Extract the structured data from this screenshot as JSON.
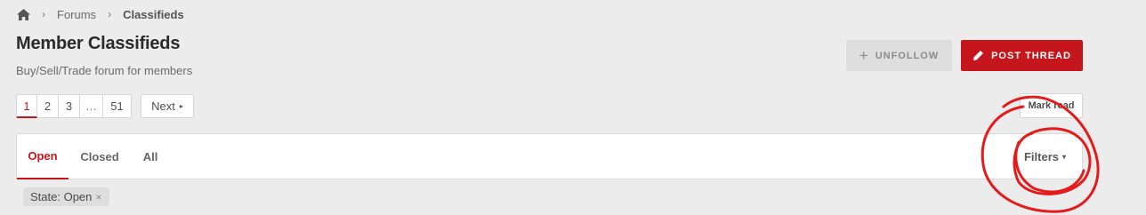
{
  "breadcrumb": {
    "home_icon": "home-icon",
    "items": [
      "Forums",
      "Classifieds"
    ],
    "separator": "›"
  },
  "header": {
    "title": "Member Classifieds",
    "description": "Buy/Sell/Trade forum for members"
  },
  "actions": {
    "unfollow_label": "UNFOLLOW",
    "unfollow_icon": "plus-icon",
    "post_thread_label": "POST THREAD",
    "post_thread_icon": "pencil-icon",
    "mark_read_label": "Mark read"
  },
  "pagination": {
    "pages": [
      "1",
      "2",
      "3",
      "…",
      "51"
    ],
    "current": "1",
    "next_label": "Next",
    "next_icon": "▸"
  },
  "filter_tabs": {
    "tabs": [
      "Open",
      "Closed",
      "All"
    ],
    "active": "Open",
    "filters_label": "Filters",
    "filters_caret": "▾"
  },
  "active_filter": {
    "label": "State: Open",
    "remove": "×"
  },
  "colors": {
    "accent": "#c4161c",
    "background": "#ececec",
    "annotation_ink": "#e31b1b"
  }
}
